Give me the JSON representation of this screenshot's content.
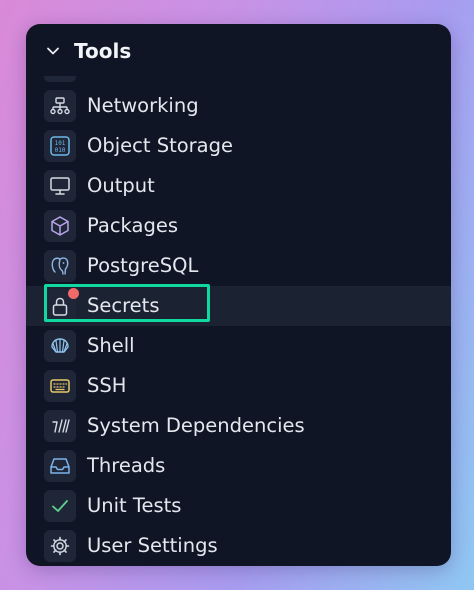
{
  "panel": {
    "title": "Tools"
  },
  "items": [
    {
      "label": "Networking",
      "icon": "network-icon"
    },
    {
      "label": "Object Storage",
      "icon": "object-storage-icon"
    },
    {
      "label": "Output",
      "icon": "monitor-icon"
    },
    {
      "label": "Packages",
      "icon": "package-cube-icon"
    },
    {
      "label": "PostgreSQL",
      "icon": "postgresql-elephant-icon"
    },
    {
      "label": "Secrets",
      "icon": "lock-icon",
      "active": true,
      "notification_dot": true
    },
    {
      "label": "Shell",
      "icon": "shell-icon"
    },
    {
      "label": "SSH",
      "icon": "keyboard-icon"
    },
    {
      "label": "System Dependencies",
      "icon": "slashes-icon"
    },
    {
      "label": "Threads",
      "icon": "inbox-tray-icon"
    },
    {
      "label": "Unit Tests",
      "icon": "checkmark-icon"
    },
    {
      "label": "User Settings",
      "icon": "gear-icon"
    }
  ],
  "colors": {
    "panel_bg": "#0f1524",
    "tile_bg": "#1f2637",
    "active_row_bg": "#1b2232",
    "highlight_border": "#10d9a0",
    "notification_dot": "#f06a6a",
    "text": "#e4e7ee"
  }
}
